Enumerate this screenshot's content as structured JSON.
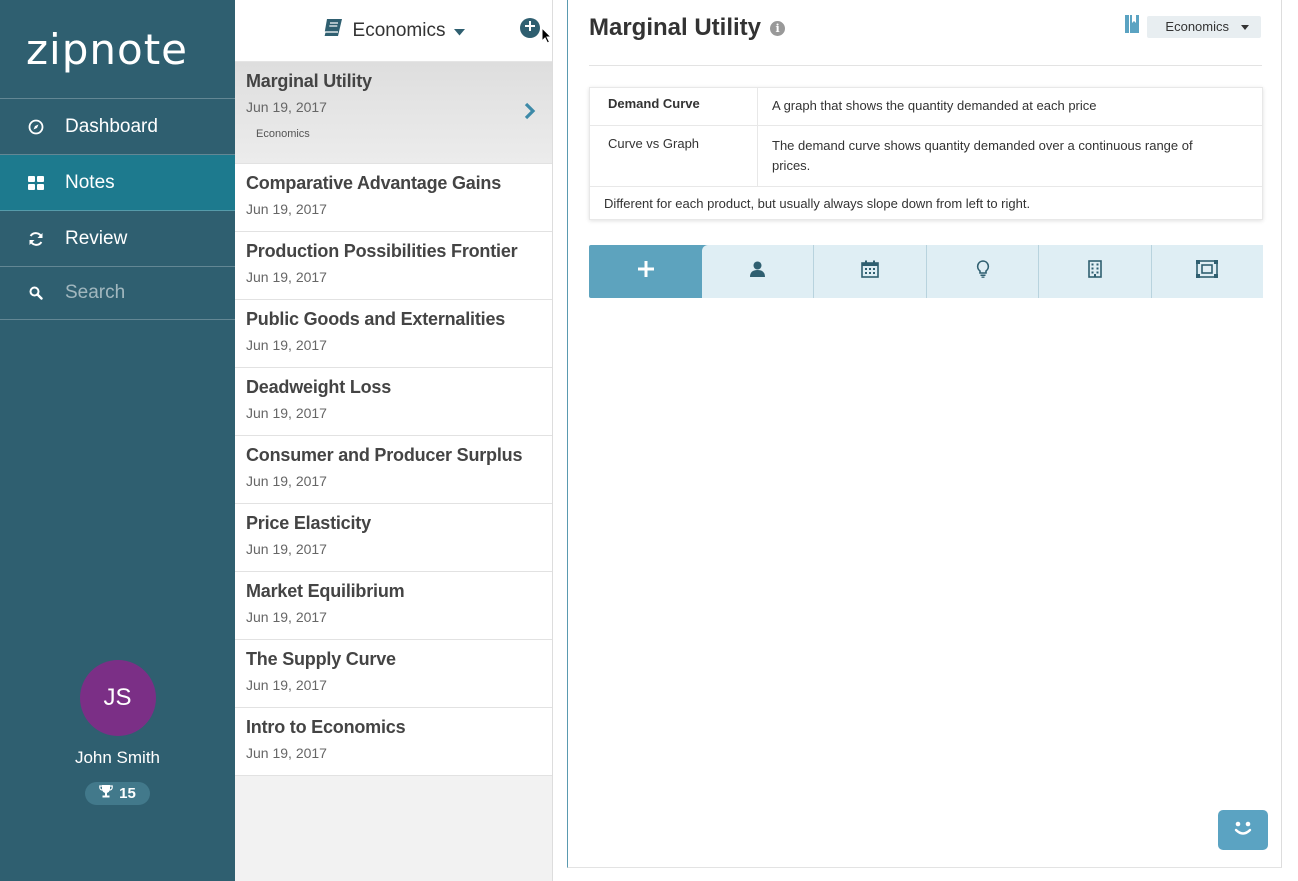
{
  "app": {
    "logo": "zipnote"
  },
  "sidebar": {
    "items": [
      {
        "label": "Dashboard",
        "icon": "compass-icon"
      },
      {
        "label": "Notes",
        "icon": "grid-icon"
      },
      {
        "label": "Review",
        "icon": "refresh-icon"
      }
    ],
    "search_placeholder": "Search"
  },
  "user": {
    "initials": "JS",
    "name": "John Smith",
    "score": "15",
    "avatar_color": "#7b2f86"
  },
  "notelist": {
    "notebook": "Economics",
    "notes": [
      {
        "title": "Marginal Utility",
        "date": "Jun 19, 2017",
        "tag": "Economics"
      },
      {
        "title": "Comparative Advantage Gains",
        "date": "Jun 19, 2017"
      },
      {
        "title": "Production Possibilities Frontier",
        "date": "Jun 19, 2017"
      },
      {
        "title": "Public Goods and Externalities",
        "date": "Jun 19, 2017"
      },
      {
        "title": "Deadweight Loss",
        "date": "Jun 19, 2017"
      },
      {
        "title": "Consumer and Producer Surplus",
        "date": "Jun 19, 2017"
      },
      {
        "title": "Price Elasticity",
        "date": "Jun 19, 2017"
      },
      {
        "title": "Market Equilibrium",
        "date": "Jun 19, 2017"
      },
      {
        "title": "The Supply Curve",
        "date": "Jun 19, 2017"
      },
      {
        "title": "Intro to Economics",
        "date": "Jun 19, 2017"
      }
    ]
  },
  "main": {
    "title": "Marginal Utility",
    "notebook_select": "Economics",
    "cards": [
      {
        "term": "Demand Curve",
        "definition": "A graph that shows the quantity demanded at each price"
      },
      {
        "term": "Curve vs Graph",
        "definition": "The demand curve shows quantity demanded over a continuous range of prices."
      }
    ],
    "note_text": "Different for each product, but usually always slope down from left to right."
  },
  "colors": {
    "sidebar": "#2f5f70",
    "active": "#1d7a8e",
    "accent": "#5da3be"
  }
}
